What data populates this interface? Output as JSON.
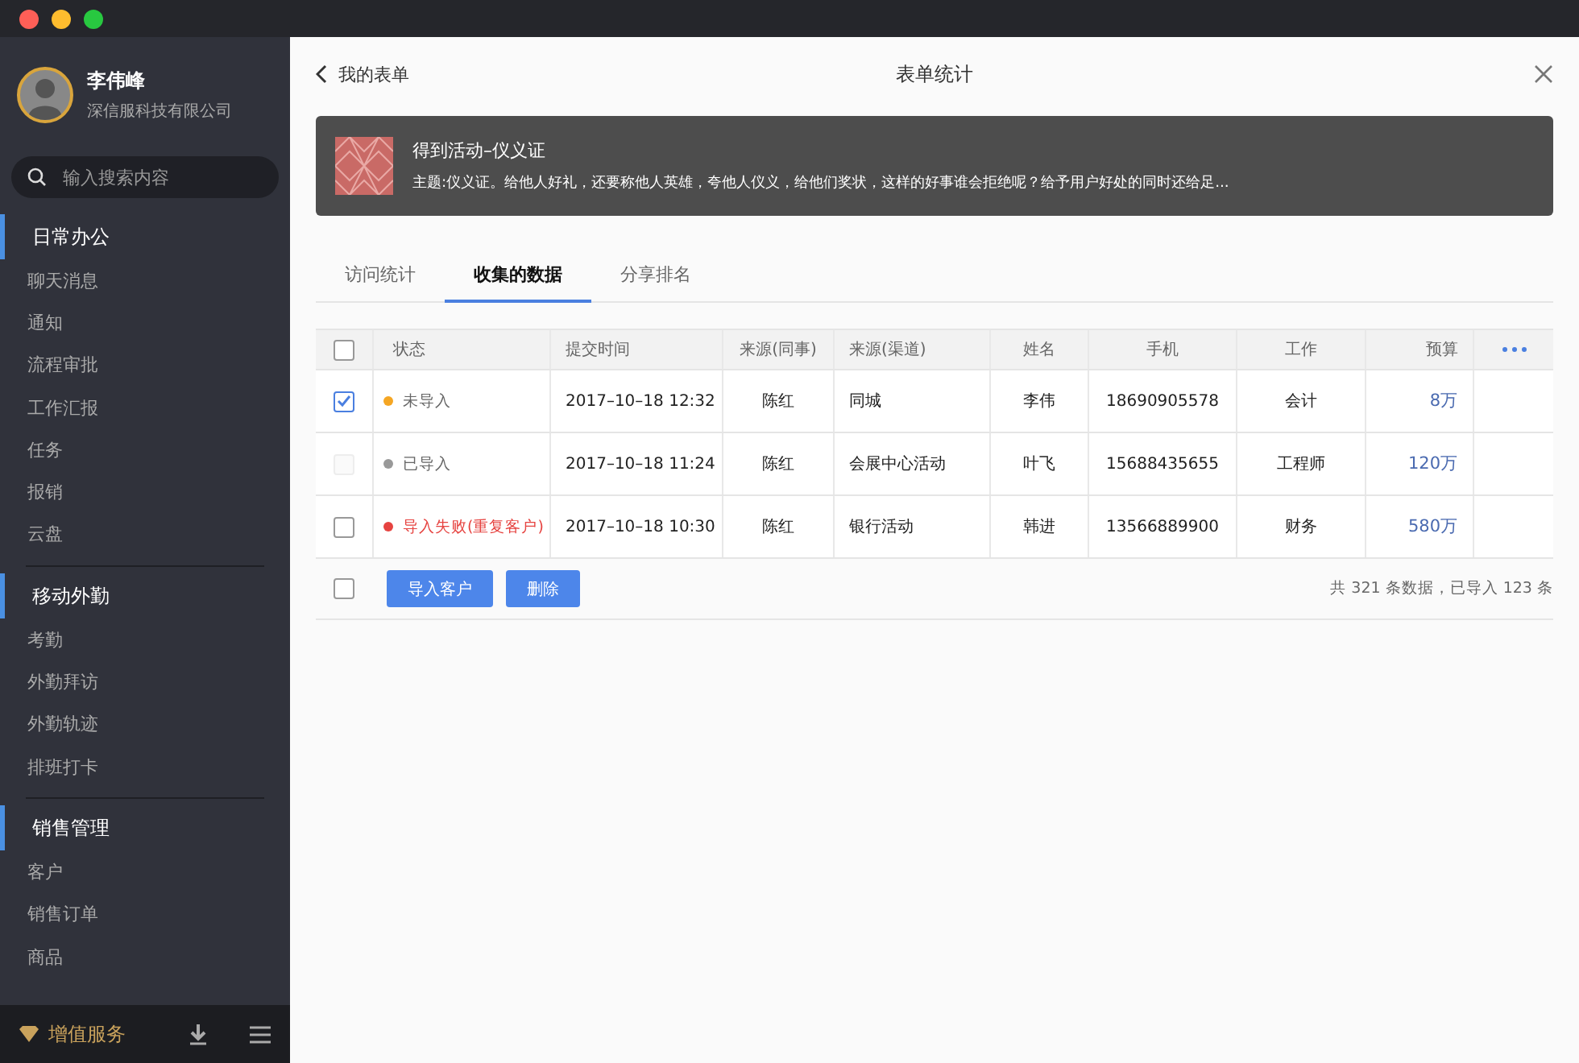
{
  "user": {
    "name": "李伟峰",
    "company": "深信服科技有限公司"
  },
  "search": {
    "placeholder": "输入搜索内容"
  },
  "sidebar": {
    "sections": [
      {
        "title": "日常办公",
        "items": [
          "聊天消息",
          "通知",
          "流程审批",
          "工作汇报",
          "任务",
          "报销",
          "云盘"
        ]
      },
      {
        "title": "移动外勤",
        "items": [
          "考勤",
          "外勤拜访",
          "外勤轨迹",
          "排班打卡"
        ]
      },
      {
        "title": "销售管理",
        "items": [
          "客户",
          "销售订单",
          "商品"
        ]
      }
    ],
    "footer": {
      "label": "增值服务"
    }
  },
  "header": {
    "back": "我的表单",
    "title": "表单统计"
  },
  "banner": {
    "title": "得到活动–仪义证",
    "subtitle": "主题:仪义证。给他人好礼，还要称他人英雄，夸他人仪义，给他们奖状，这样的好事谁会拒绝呢？给予用户好处的同时还给足..."
  },
  "tabs": [
    {
      "label": "访问统计",
      "selected": false
    },
    {
      "label": "收集的数据",
      "selected": true
    },
    {
      "label": "分享排名",
      "selected": false
    }
  ],
  "table": {
    "all_checked": false,
    "columns": [
      "状态",
      "提交时间",
      "来源(同事)",
      "来源(渠道)",
      "姓名",
      "手机",
      "工作",
      "预算"
    ],
    "rows": [
      {
        "checked": true,
        "disabled": false,
        "color": "#f5a623",
        "error": false,
        "cells": [
          "未导入",
          "2017–10–18 12:32",
          "陈红",
          "同城",
          "李伟",
          "18690905578",
          "会计",
          "8万"
        ]
      },
      {
        "checked": false,
        "disabled": true,
        "color": "#999999",
        "error": false,
        "cells": [
          "已导入",
          "2017–10–18 11:24",
          "陈红",
          "会展中心活动",
          "叶飞",
          "15688435655",
          "工程师",
          "120万"
        ]
      },
      {
        "checked": false,
        "disabled": false,
        "color": "#e64340",
        "error": true,
        "cells": [
          "导入失败(重复客户)",
          "2017–10–18 10:30",
          "陈红",
          "银行活动",
          "韩进",
          "13566889900",
          "财务",
          "580万"
        ]
      }
    ]
  },
  "footer": {
    "checked": false,
    "buttons": [
      "导入客户",
      "删除"
    ],
    "summary": "共 321 条数据，已导入 123 条"
  }
}
